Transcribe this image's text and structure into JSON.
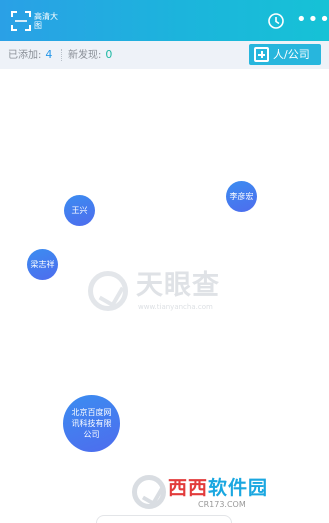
{
  "header": {
    "scan_label": "高清大图",
    "history_icon": "clock-icon",
    "more_label": "•••",
    "background_colors": [
      "#2aa0e6",
      "#16c2d6"
    ]
  },
  "stats": {
    "added_label": "已添加:",
    "added_count": "4",
    "new_found_label": "新发现:",
    "new_found_count": "0"
  },
  "add_button": {
    "label": "人/公司",
    "color": "#27b6dd"
  },
  "graph": {
    "nodes": [
      {
        "id": "wangxing",
        "label": "王兴"
      },
      {
        "id": "liyanhong",
        "label": "李彦宏"
      },
      {
        "id": "liangzhixiang",
        "label": "梁志祥"
      },
      {
        "id": "baidu",
        "label": "北京百度网讯科技有限公司"
      }
    ],
    "node_color": "#4a7af0"
  },
  "watermark": {
    "title": "天眼查",
    "url": "www.tianyancha.com"
  },
  "banner": {
    "title_part1": "西西",
    "title_part2": "软件园",
    "url": "CR173.COM"
  }
}
